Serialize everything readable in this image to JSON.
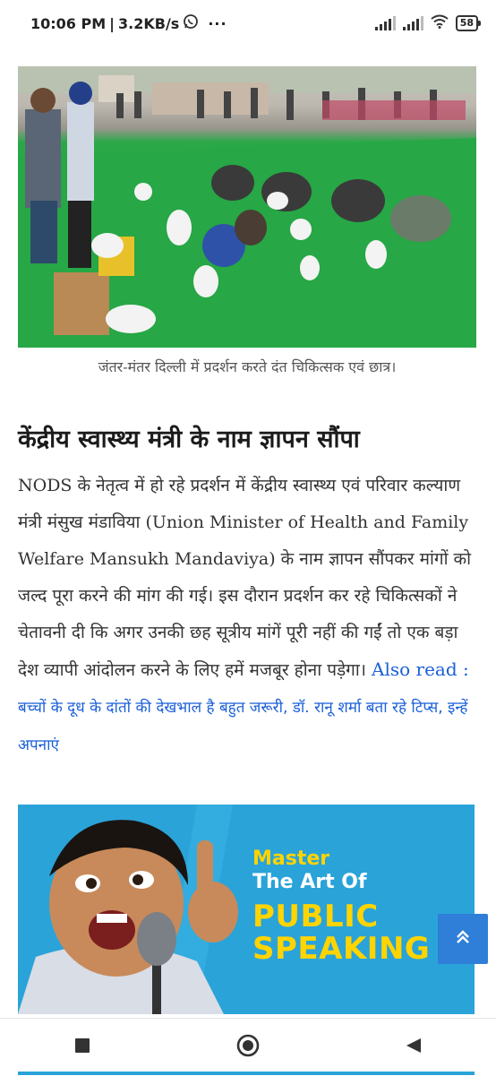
{
  "status_bar": {
    "time": "10:06 PM",
    "net_speed": "3.2KB/s",
    "battery": "58"
  },
  "article": {
    "caption": "जंतर-मंतर दिल्ली में प्रदर्शन करते दंत चिकित्सक एवं छात्र।",
    "heading": "केंद्रीय स्वास्थ्य मंत्री के नाम ज्ञापन सौंपा",
    "paragraph": "NODS के नेतृत्व में हो रहे प्रदर्शन में केंद्रीय स्वास्थ्य एवं परिवार कल्याण मंत्री मंसुख मंडाविया (Union Minister of Health and Family Welfare Mansukh Mandaviya) के नाम ज्ञापन सौंपकर मांगों को जल्द पूरा करने की मांग की गई। इस दौरान प्रदर्शन कर रहे चिकित्सकों ने चेतावनी दी कि अगर उनकी छह सूत्रीय मांगें पूरी नहीं की गईं तो एक बड़ा देश व्यापी आंदोलन करने के लिए हमें मजबूर होना पड़ेगा।",
    "also_read_label": "Also read :",
    "also_read_title": "बच्चों के दूध के दांतों की देखभाल है बहुत जरूरी, डॉ. रानू शर्मा बता रहे टिप्स, इन्हें अपनाएं"
  },
  "ad": {
    "line1": "Master",
    "line2": "The Art Of",
    "line3": "PUBLIC",
    "line4": "SPEAKING"
  },
  "colors": {
    "link": "#1a5fd8",
    "ad_bg": "#2aa3d9",
    "ad_yellow": "#ffd400",
    "scroll_btn": "#2f7ed8"
  }
}
